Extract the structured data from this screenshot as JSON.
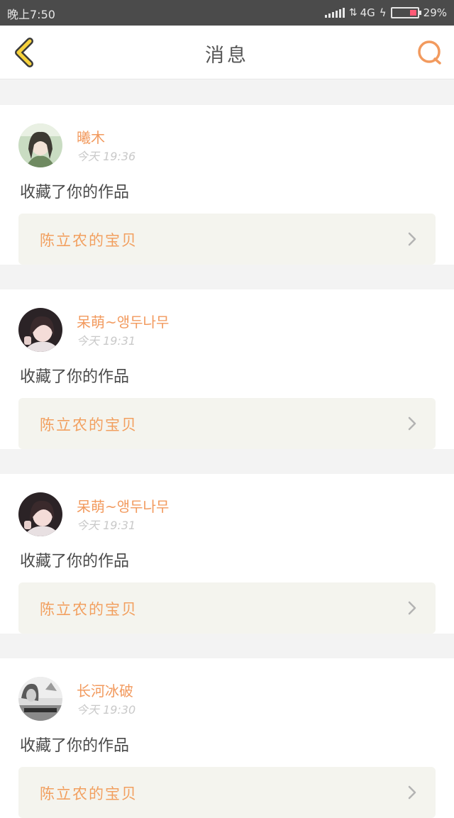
{
  "status_bar": {
    "time": "晚上7:50",
    "network": "4G",
    "battery_percent": "29%",
    "battery_level": 0.29,
    "battery_color": "#ff5a76"
  },
  "nav": {
    "title": "消息",
    "back_icon": "chevron-left-icon",
    "search_icon": "search-icon",
    "accent_back": "#f7d23c",
    "accent_search": "#f29a5e"
  },
  "messages": [
    {
      "user": "曦木",
      "time": "今天 19:36",
      "action": "收藏了你的作品",
      "work": "陈立农的宝贝",
      "avatar": "avatar-green"
    },
    {
      "user": "呆萌~앵두나무",
      "time": "今天 19:31",
      "action": "收藏了你的作品",
      "work": "陈立农的宝贝",
      "avatar": "avatar-dark"
    },
    {
      "user": "呆萌~앵두나무",
      "time": "今天 19:31",
      "action": "收藏了你的作品",
      "work": "陈立农的宝贝",
      "avatar": "avatar-dark"
    },
    {
      "user": "长河冰破",
      "time": "今天 19:30",
      "action": "收藏了你的作品",
      "work": "陈立农的宝贝",
      "avatar": "avatar-gray"
    }
  ]
}
